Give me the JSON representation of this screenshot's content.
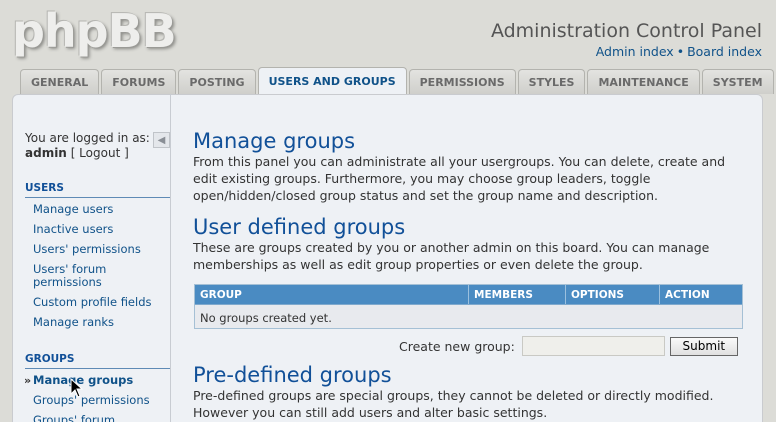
{
  "header": {
    "logo_text": "phpBB",
    "title": "Administration Control Panel",
    "links": [
      "Admin index",
      "Board index"
    ],
    "link_separator": "•"
  },
  "tabs": [
    {
      "label": "GENERAL",
      "active": false
    },
    {
      "label": "FORUMS",
      "active": false
    },
    {
      "label": "POSTING",
      "active": false
    },
    {
      "label": "USERS AND GROUPS",
      "active": true
    },
    {
      "label": "PERMISSIONS",
      "active": false
    },
    {
      "label": "STYLES",
      "active": false
    },
    {
      "label": "MAINTENANCE",
      "active": false
    },
    {
      "label": "SYSTEM",
      "active": false
    }
  ],
  "sidebar": {
    "login_prefix": "You are logged in as:",
    "username": "admin",
    "logout_label": "[ Logout ]",
    "collapse_icon": "◀",
    "users_heading": "USERS",
    "users_items": [
      "Manage users",
      "Inactive users",
      "Users' permissions",
      "Users' forum permissions",
      "Custom profile fields",
      "Manage ranks"
    ],
    "groups_heading": "GROUPS",
    "groups_items": [
      "Manage groups",
      "Groups' permissions",
      "Groups' forum"
    ],
    "active_item": "Manage groups"
  },
  "main": {
    "title": "Manage groups",
    "intro": "From this panel you can administrate all your usergroups. You can delete, create and edit existing groups. Furthermore, you may choose group leaders, toggle open/hidden/closed group status and set the group name and description.",
    "user_defined_title": "User defined groups",
    "user_defined_desc": "These are groups created by you or another admin on this board. You can manage memberships as well as edit group properties or even delete the group.",
    "table": {
      "columns": [
        "GROUP",
        "MEMBERS",
        "OPTIONS",
        "ACTION"
      ],
      "empty_message": "No groups created yet."
    },
    "create_label": "Create new group:",
    "create_value": "",
    "submit_label": "Submit",
    "predefined_title": "Pre-defined groups",
    "predefined_desc": "Pre-defined groups are special groups, they cannot be deleted or directly modified. However you can still add users and alter basic settings."
  },
  "colors": {
    "accent": "#115098",
    "table_header": "#4a8bc2",
    "panel_bg": "#eef1f5",
    "page_bg": "#dcdcd7"
  }
}
